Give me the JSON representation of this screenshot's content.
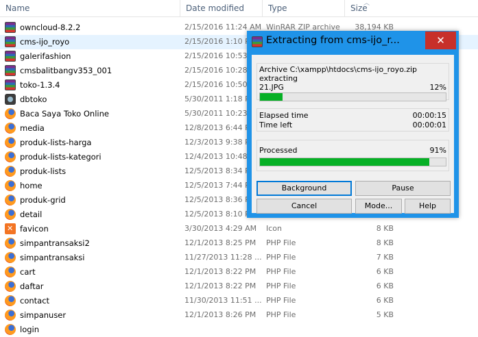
{
  "columns": {
    "name": "Name",
    "date": "Date modified",
    "type": "Type",
    "size": "Size"
  },
  "files": [
    {
      "icon": "winrar-archive-icon",
      "name": "owncloud-8.2.2",
      "date": "2/15/2016 11:24 AM",
      "type": "WinRAR ZIP archive",
      "size": "38,194 KB"
    },
    {
      "icon": "winrar-archive-icon",
      "name": "cms-ijo_royo",
      "date": "2/15/2016 1:10 P",
      "type": "",
      "size": ""
    },
    {
      "icon": "winrar-archive-icon",
      "name": "galerifashion",
      "date": "2/15/2016 10:53 A",
      "type": "",
      "size": ""
    },
    {
      "icon": "winrar-archive-icon",
      "name": "cmsbalitbangv353_001",
      "date": "2/15/2016 10:28 A",
      "type": "",
      "size": ""
    },
    {
      "icon": "winrar-archive-icon",
      "name": "toko-1.3.4",
      "date": "2/15/2016 10:50 A",
      "type": "",
      "size": ""
    },
    {
      "icon": "database-icon",
      "name": "dbtoko",
      "date": "5/30/2011 1:18 P",
      "type": "",
      "size": ""
    },
    {
      "icon": "firefox-icon",
      "name": "Baca Saya Toko Online",
      "date": "5/30/2011 10:23 A",
      "type": "",
      "size": ""
    },
    {
      "icon": "firefox-icon",
      "name": "media",
      "date": "12/8/2013 6:44 P",
      "type": "",
      "size": ""
    },
    {
      "icon": "firefox-icon",
      "name": "produk-lists-harga",
      "date": "12/3/2013 9:38 P",
      "type": "",
      "size": ""
    },
    {
      "icon": "firefox-icon",
      "name": "produk-lists-kategori",
      "date": "12/4/2013 10:48 F",
      "type": "",
      "size": ""
    },
    {
      "icon": "firefox-icon",
      "name": "produk-lists",
      "date": "12/5/2013 8:34 P",
      "type": "",
      "size": ""
    },
    {
      "icon": "firefox-icon",
      "name": "home",
      "date": "12/5/2013 7:44 P",
      "type": "",
      "size": ""
    },
    {
      "icon": "firefox-icon",
      "name": "produk-grid",
      "date": "12/5/2013 8:36 P",
      "type": "",
      "size": ""
    },
    {
      "icon": "firefox-icon",
      "name": "detail",
      "date": "12/5/2013 8:10 P",
      "type": "",
      "size": ""
    },
    {
      "icon": "xampp-icon",
      "name": "favicon",
      "date": "3/30/2013 4:29 AM",
      "type": "Icon",
      "size": "8 KB"
    },
    {
      "icon": "firefox-icon",
      "name": "simpantransaksi2",
      "date": "12/1/2013 8:25 PM",
      "type": "PHP File",
      "size": "8 KB"
    },
    {
      "icon": "firefox-icon",
      "name": "simpantransaksi",
      "date": "11/27/2013 11:28 ...",
      "type": "PHP File",
      "size": "7 KB"
    },
    {
      "icon": "firefox-icon",
      "name": "cart",
      "date": "12/1/2013 8:22 PM",
      "type": "PHP File",
      "size": "6 KB"
    },
    {
      "icon": "firefox-icon",
      "name": "daftar",
      "date": "12/1/2013 8:22 PM",
      "type": "PHP File",
      "size": "6 KB"
    },
    {
      "icon": "firefox-icon",
      "name": "contact",
      "date": "11/30/2013 11:51 ...",
      "type": "PHP File",
      "size": "6 KB"
    },
    {
      "icon": "firefox-icon",
      "name": "simpanuser",
      "date": "12/1/2013 8:26 PM",
      "type": "PHP File",
      "size": "5 KB"
    },
    {
      "icon": "firefox-icon",
      "name": "login",
      "date": "",
      "type": "",
      "size": ""
    }
  ],
  "dialog": {
    "title": "Extracting from cms-ijo_r...",
    "close_glyph": "✕",
    "archive_line": "Archive C:\\xampp\\htdocs\\cms-ijo_royo.zip",
    "action": "extracting",
    "current_file": "21.JPG",
    "file_percent_label": "12%",
    "file_progress": 0.12,
    "elapsed_label": "Elapsed time",
    "elapsed_value": "00:00:15",
    "left_label": "Time left",
    "left_value": "00:00:01",
    "processed_label": "Processed",
    "processed_percent_label": "91%",
    "processed_progress": 0.91,
    "buttons": {
      "background": "Background",
      "pause": "Pause",
      "cancel": "Cancel",
      "mode": "Mode...",
      "help": "Help"
    }
  },
  "colors": {
    "accent": "#1f93e8",
    "progress": "#06b025",
    "close": "#c7302a",
    "selection": "#e5f3ff"
  }
}
